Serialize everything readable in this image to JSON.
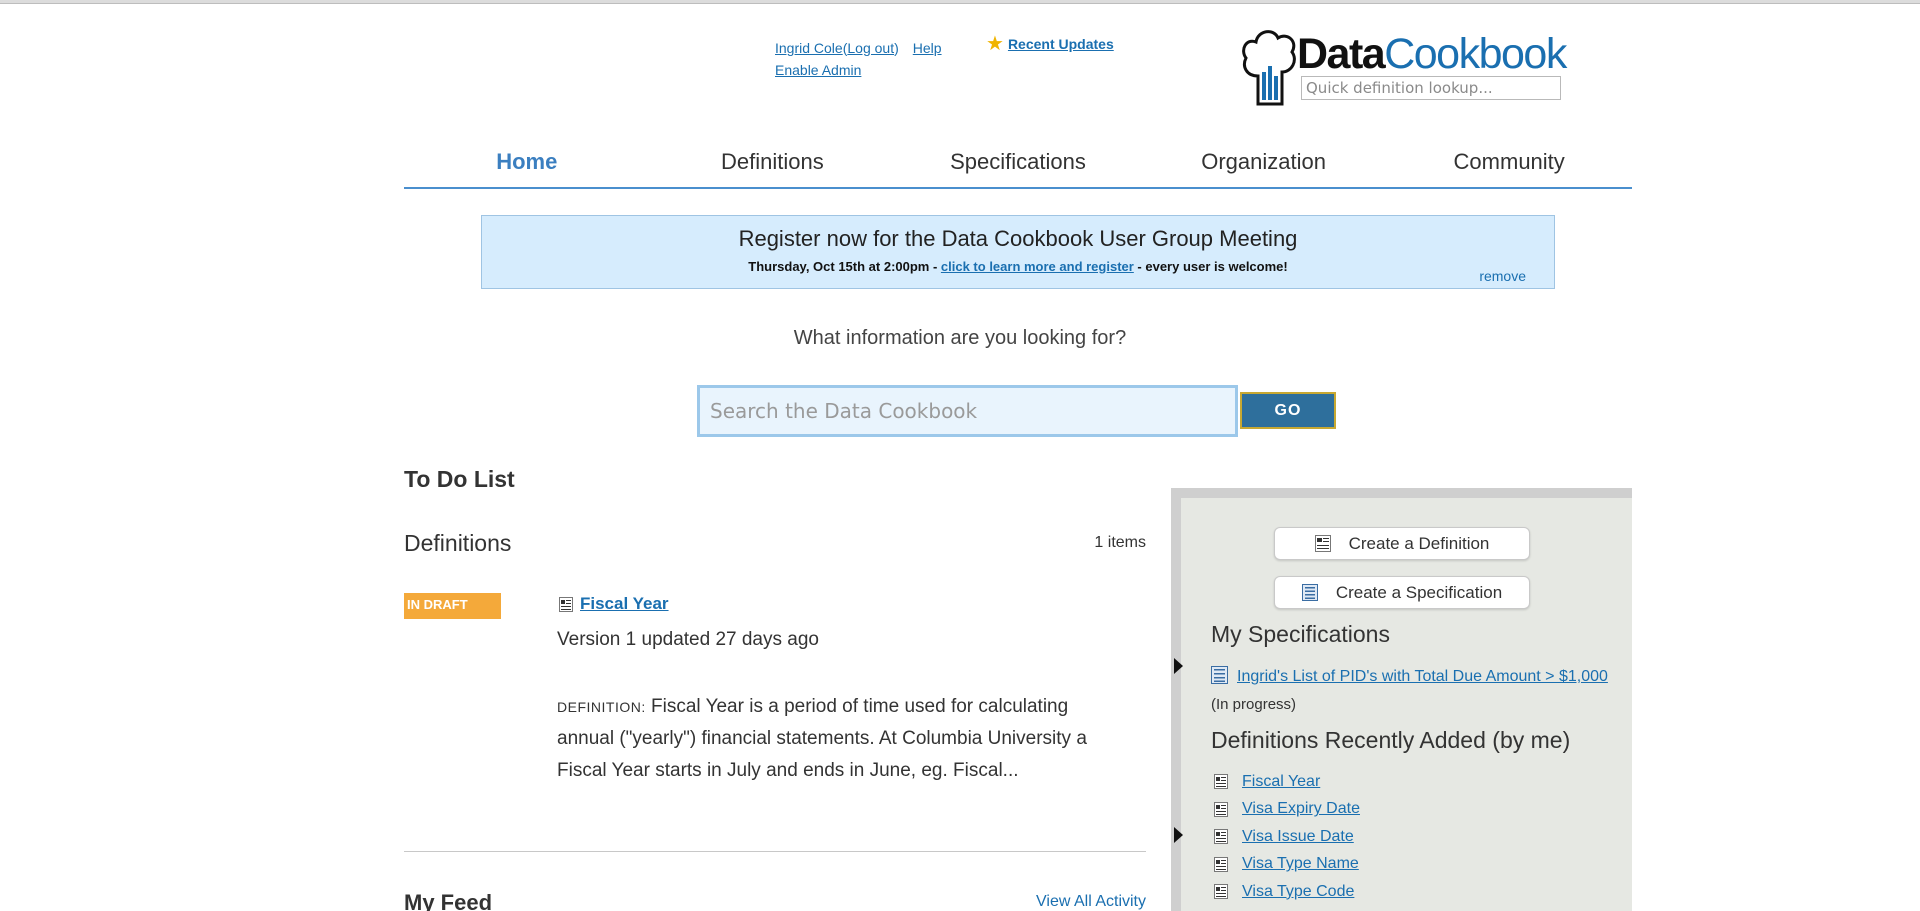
{
  "header": {
    "user_name": "Ingrid Cole",
    "logout_label": "Log out",
    "help_label": "Help",
    "enable_admin_label": "Enable Admin",
    "recent_updates_label": "Recent Updates",
    "logo_word1": "Data",
    "logo_word2": "Cookbook",
    "quick_lookup_placeholder": "Quick definition lookup..."
  },
  "nav": {
    "tabs": [
      {
        "label": "Home",
        "active": true
      },
      {
        "label": "Definitions",
        "active": false
      },
      {
        "label": "Specifications",
        "active": false
      },
      {
        "label": "Organization",
        "active": false
      },
      {
        "label": "Community",
        "active": false
      }
    ]
  },
  "banner": {
    "title": "Register now for the Data Cookbook User Group Meeting",
    "line_prefix": "Thursday, Oct 15th at 2:00pm - ",
    "link_label": "click to learn more and register",
    "line_suffix": " - every user is welcome!",
    "remove_label": "remove"
  },
  "search": {
    "question": "What information are you looking for?",
    "placeholder": "Search the Data Cookbook",
    "go_label": "GO"
  },
  "todo": {
    "title": "To Do List",
    "section_title": "Definitions",
    "count_label": "1 items",
    "item": {
      "status": "IN DRAFT",
      "name": "Fiscal Year",
      "version_text": "Version 1 updated 27 days ago",
      "def_label": "DEFINITION:",
      "def_text": " Fiscal Year is a period of time used for calculating annual (\"yearly\") financial statements. At Columbia University a Fiscal Year starts in July and ends in June, eg. Fiscal..."
    }
  },
  "feed": {
    "title": "My Feed",
    "view_all_label": "View All Activity"
  },
  "panel": {
    "create_definition_label": "Create a Definition",
    "create_specification_label": "Create a Specification",
    "my_specs_title": "My Specifications",
    "spec_link_label": "Ingrid's List of PID's with Total Due Amount > $1,000",
    "spec_status": " (In progress)",
    "recent_title": "Definitions Recently Added (by me)",
    "recent_items": [
      "Fiscal Year",
      "Visa Expiry Date",
      "Visa Issue Date",
      "Visa Type Name",
      "Visa Type Code"
    ]
  },
  "colors": {
    "accent": "#1a6fb0",
    "nav_active": "#3b7fc0",
    "draft_badge": "#f4a93a",
    "banner_bg": "#d6ecfd",
    "go_button": "#2e6f9c",
    "panel_bg": "#e6e8e3"
  }
}
